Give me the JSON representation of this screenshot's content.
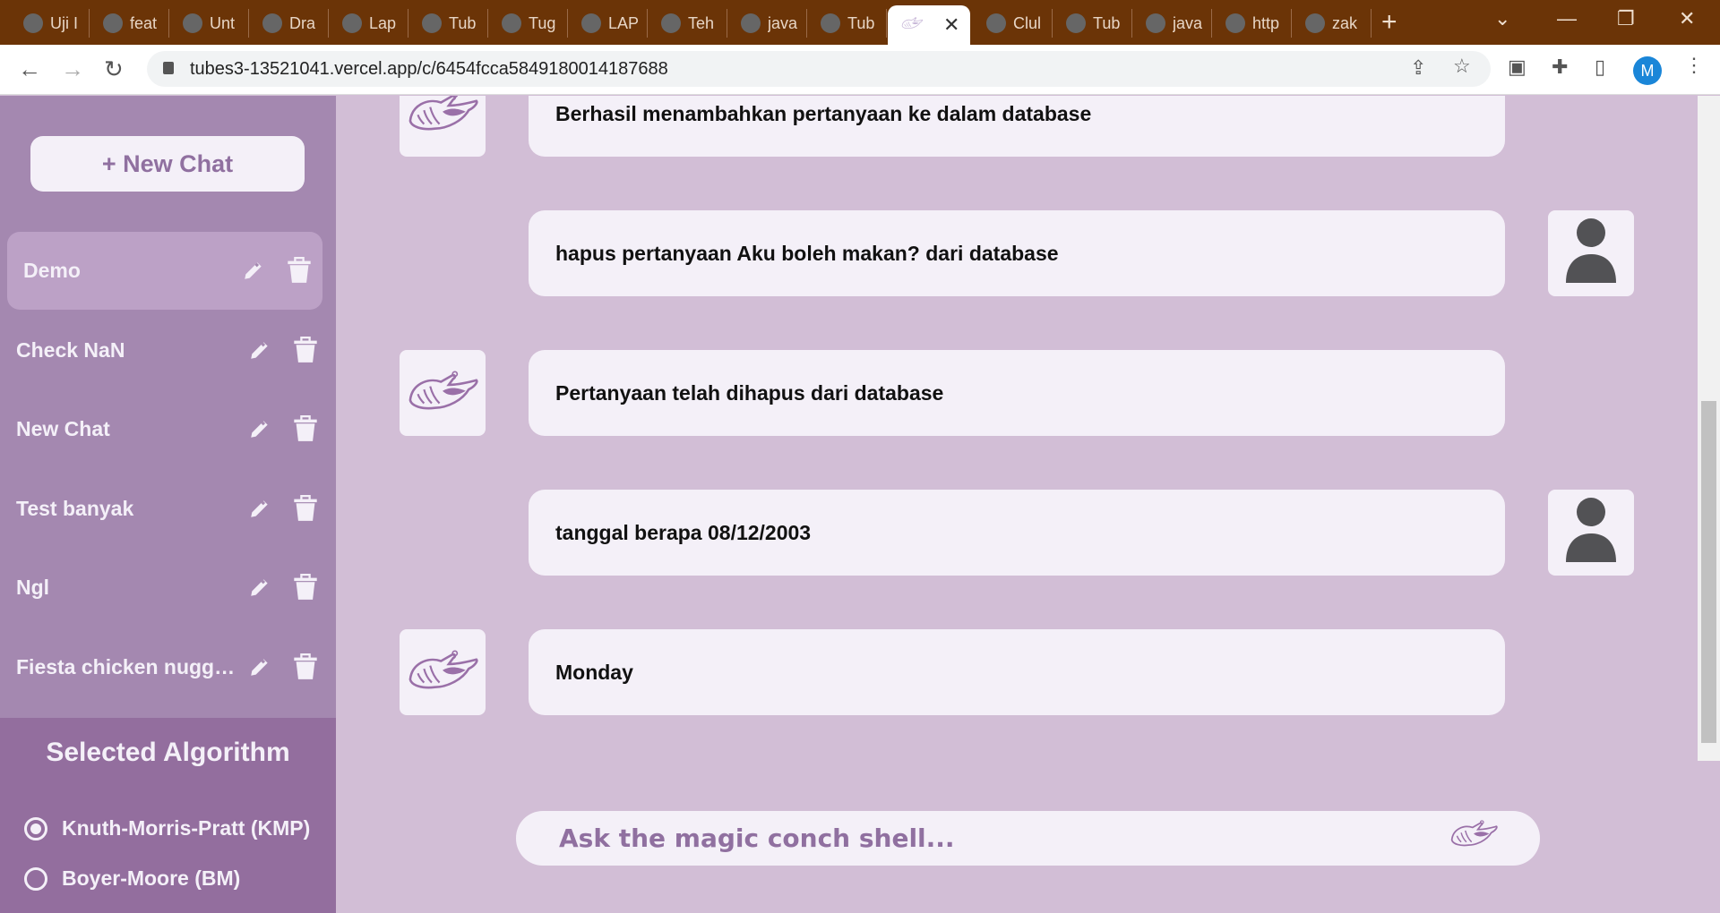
{
  "browser": {
    "tabs": [
      {
        "title": "Uji I"
      },
      {
        "title": "feat"
      },
      {
        "title": "Unt"
      },
      {
        "title": "Dra"
      },
      {
        "title": "Lap"
      },
      {
        "title": "Tub"
      },
      {
        "title": "Tug"
      },
      {
        "title": "LAP"
      },
      {
        "title": "Teh"
      },
      {
        "title": "java"
      },
      {
        "title": "Tub"
      },
      {
        "title": "",
        "active": true
      },
      {
        "title": "Clul"
      },
      {
        "title": "Tub"
      },
      {
        "title": "java"
      },
      {
        "title": "http"
      },
      {
        "title": "zak"
      }
    ],
    "url": "tubes3-13521041.vercel.app/c/6454fcca5849180014187688",
    "profile_initial": "M"
  },
  "sidebar": {
    "new_chat_label": "+ New Chat",
    "items": [
      {
        "label": "Demo",
        "selected": true
      },
      {
        "label": "Check NaN"
      },
      {
        "label": "New Chat"
      },
      {
        "label": "Test banyak"
      },
      {
        "label": "Ngl"
      },
      {
        "label": "Fiesta chicken nuggets"
      }
    ],
    "algorithm": {
      "title": "Selected Algorithm",
      "options": [
        {
          "label": "Knuth-Morris-Pratt (KMP)",
          "checked": true
        },
        {
          "label": "Boyer-Moore (BM)",
          "checked": false
        }
      ]
    }
  },
  "messages": [
    {
      "sender": "bot",
      "text": "Berhasil menambahkan pertanyaan ke dalam database"
    },
    {
      "sender": "user",
      "text": "hapus pertanyaan Aku boleh makan? dari database"
    },
    {
      "sender": "bot",
      "text": "Pertanyaan telah dihapus dari database"
    },
    {
      "sender": "user",
      "text": "tanggal berapa 08/12/2003"
    },
    {
      "sender": "bot",
      "text": "Monday"
    }
  ],
  "input": {
    "placeholder": "Ask the magic conch shell...",
    "value": ""
  },
  "colors": {
    "sidebar": "#a488b0",
    "sidebar_selected": "#bca1c6",
    "algo_panel": "#936e9e",
    "main_bg": "#d2bed6",
    "bubble": "#f4f0f8",
    "accent": "#9070a0"
  }
}
